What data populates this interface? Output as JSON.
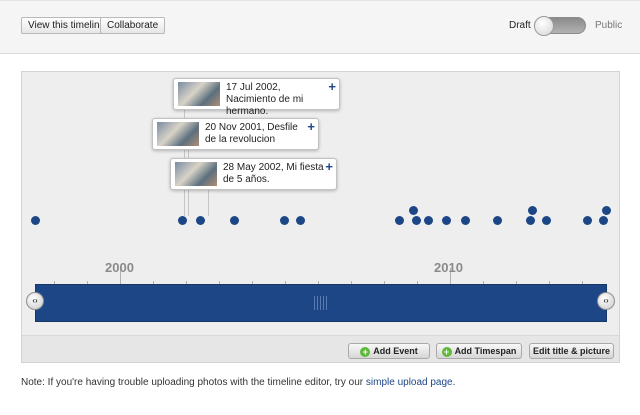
{
  "toolbar": {
    "view_label": "View this timeline",
    "collaborate_label": "Collaborate",
    "draft_label": "Draft",
    "public_label": "Public"
  },
  "timeline": {
    "events": [
      {
        "label": "17 Jul 2002, Nacimiento de mi hermano."
      },
      {
        "label": "20 Nov 2001, Desfile de la revolucion"
      },
      {
        "label": "28 May 2002, Mi fiesta de 5 años."
      }
    ],
    "axis_years": [
      "2000",
      "2010"
    ],
    "nav_left_glyph": "‹›",
    "nav_right_glyph": "‹›"
  },
  "actions": {
    "add_event_label": "Add Event",
    "add_timespan_label": "Add Timespan",
    "edit_title_label": "Edit title & picture",
    "plus_glyph": "+"
  },
  "note": {
    "text": "Note: If you're having trouble uploading photos with the timeline editor, try our ",
    "link_text": "simple upload page",
    "suffix": "."
  },
  "colors": {
    "accent": "#1d4687",
    "panel": "#eeeeee"
  },
  "icons": {
    "event_add": "plus-icon",
    "button_add": "green-plus-icon",
    "nav": "arrows-icon"
  }
}
